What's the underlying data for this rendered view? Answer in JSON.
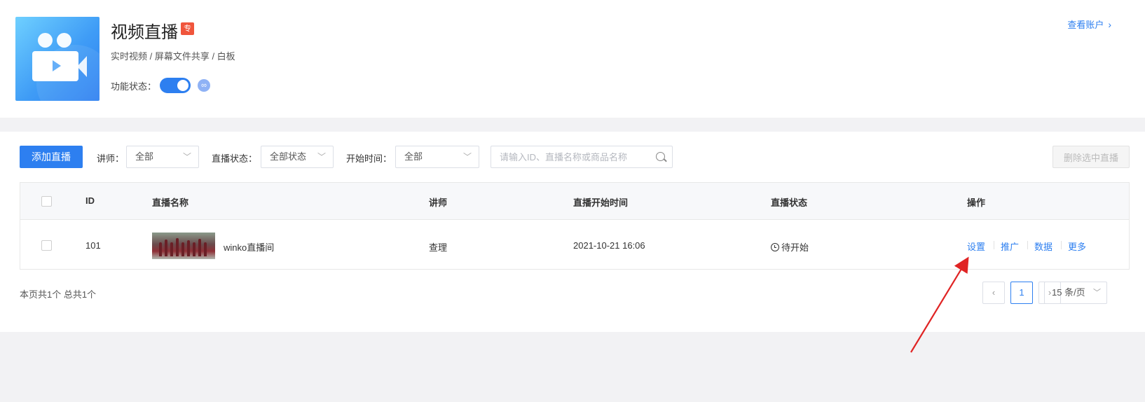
{
  "header": {
    "title": "视频直播",
    "badge": "专",
    "subtitle": "实时视频 / 屏幕文件共享 / 白板",
    "status_label": "功能状态：",
    "toggle_on": true,
    "account_link": "查看账户",
    "accent_color": "#2d7ff0"
  },
  "toolbar": {
    "add_button": "添加直播",
    "lecturer_label": "讲师：",
    "lecturer_value": "全部",
    "status_label": "直播状态：",
    "status_value": "全部状态",
    "start_time_label": "开始时间：",
    "start_time_value": "全部",
    "search_placeholder": "请输入ID、直播名称或商品名称",
    "delete_button": "删除选中直播"
  },
  "table": {
    "columns": [
      "ID",
      "直播名称",
      "讲师",
      "直播开始时间",
      "直播状态",
      "操作"
    ],
    "rows": [
      {
        "id": "101",
        "name": "winko直播间",
        "lecturer": "查理",
        "start_time": "2021-10-21 16:06",
        "status": "待开始",
        "actions": [
          "设置",
          "推广",
          "数据",
          "更多"
        ]
      }
    ]
  },
  "pagination": {
    "summary": "本页共1个 总共1个",
    "prev": "‹",
    "current_page": "1",
    "next": "›",
    "page_size": "15 条/页"
  }
}
